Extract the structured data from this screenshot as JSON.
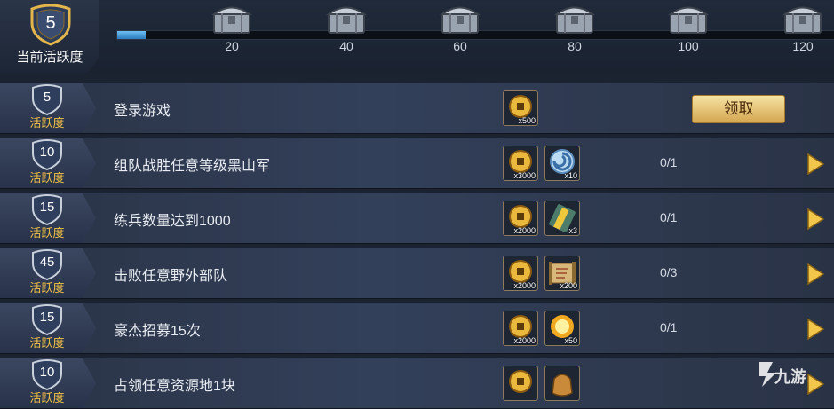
{
  "activity": {
    "current_value": "5",
    "current_label": "当前活跃度",
    "progress_fraction": 0.04
  },
  "milestones": [
    {
      "label": "20",
      "icon": "silver-chest-icon"
    },
    {
      "label": "40",
      "icon": "silver-chest-icon"
    },
    {
      "label": "60",
      "icon": "silver-chest-icon"
    },
    {
      "label": "80",
      "icon": "silver-chest-icon"
    },
    {
      "label": "100",
      "icon": "silver-chest-icon"
    },
    {
      "label": "120",
      "icon": "silver-chest-icon"
    }
  ],
  "points_label": "活跃度",
  "tasks": [
    {
      "points": "5",
      "title": "登录游戏",
      "rewards": [
        {
          "icon": "copper-coin-icon",
          "qty": "x500"
        }
      ],
      "progress": "",
      "action": "领取"
    },
    {
      "points": "10",
      "title": "组队战胜任意等级黑山军",
      "rewards": [
        {
          "icon": "copper-coin-icon",
          "qty": "x3000"
        },
        {
          "icon": "blue-spiral-token-icon",
          "qty": "x10"
        }
      ],
      "progress": "0/1",
      "action": ""
    },
    {
      "points": "15",
      "title": "练兵数量达到1000",
      "rewards": [
        {
          "icon": "copper-coin-icon",
          "qty": "x2000"
        },
        {
          "icon": "training-scroll-icon",
          "qty": "x3"
        }
      ],
      "progress": "0/1",
      "action": ""
    },
    {
      "points": "45",
      "title": "击败任意野外部队",
      "rewards": [
        {
          "icon": "copper-coin-icon",
          "qty": "x2000"
        },
        {
          "icon": "map-scroll-icon",
          "qty": "x200"
        }
      ],
      "progress": "0/3",
      "action": ""
    },
    {
      "points": "15",
      "title": "豪杰招募15次",
      "rewards": [
        {
          "icon": "copper-coin-icon",
          "qty": "x2000"
        },
        {
          "icon": "gold-orb-icon",
          "qty": "x50"
        }
      ],
      "progress": "0/1",
      "action": ""
    },
    {
      "points": "10",
      "title": "占领任意资源地1块",
      "rewards": [
        {
          "icon": "copper-coin-icon",
          "qty": ""
        },
        {
          "icon": "resource-pouch-icon",
          "qty": ""
        }
      ],
      "progress": "",
      "action": ""
    }
  ],
  "watermark": {
    "text": "九游",
    "icon": "jiuyou-logo-icon"
  },
  "colors": {
    "gold": "#f1c245",
    "progress_fill": "#3e9de0",
    "claim_button": "#e9c97c"
  }
}
